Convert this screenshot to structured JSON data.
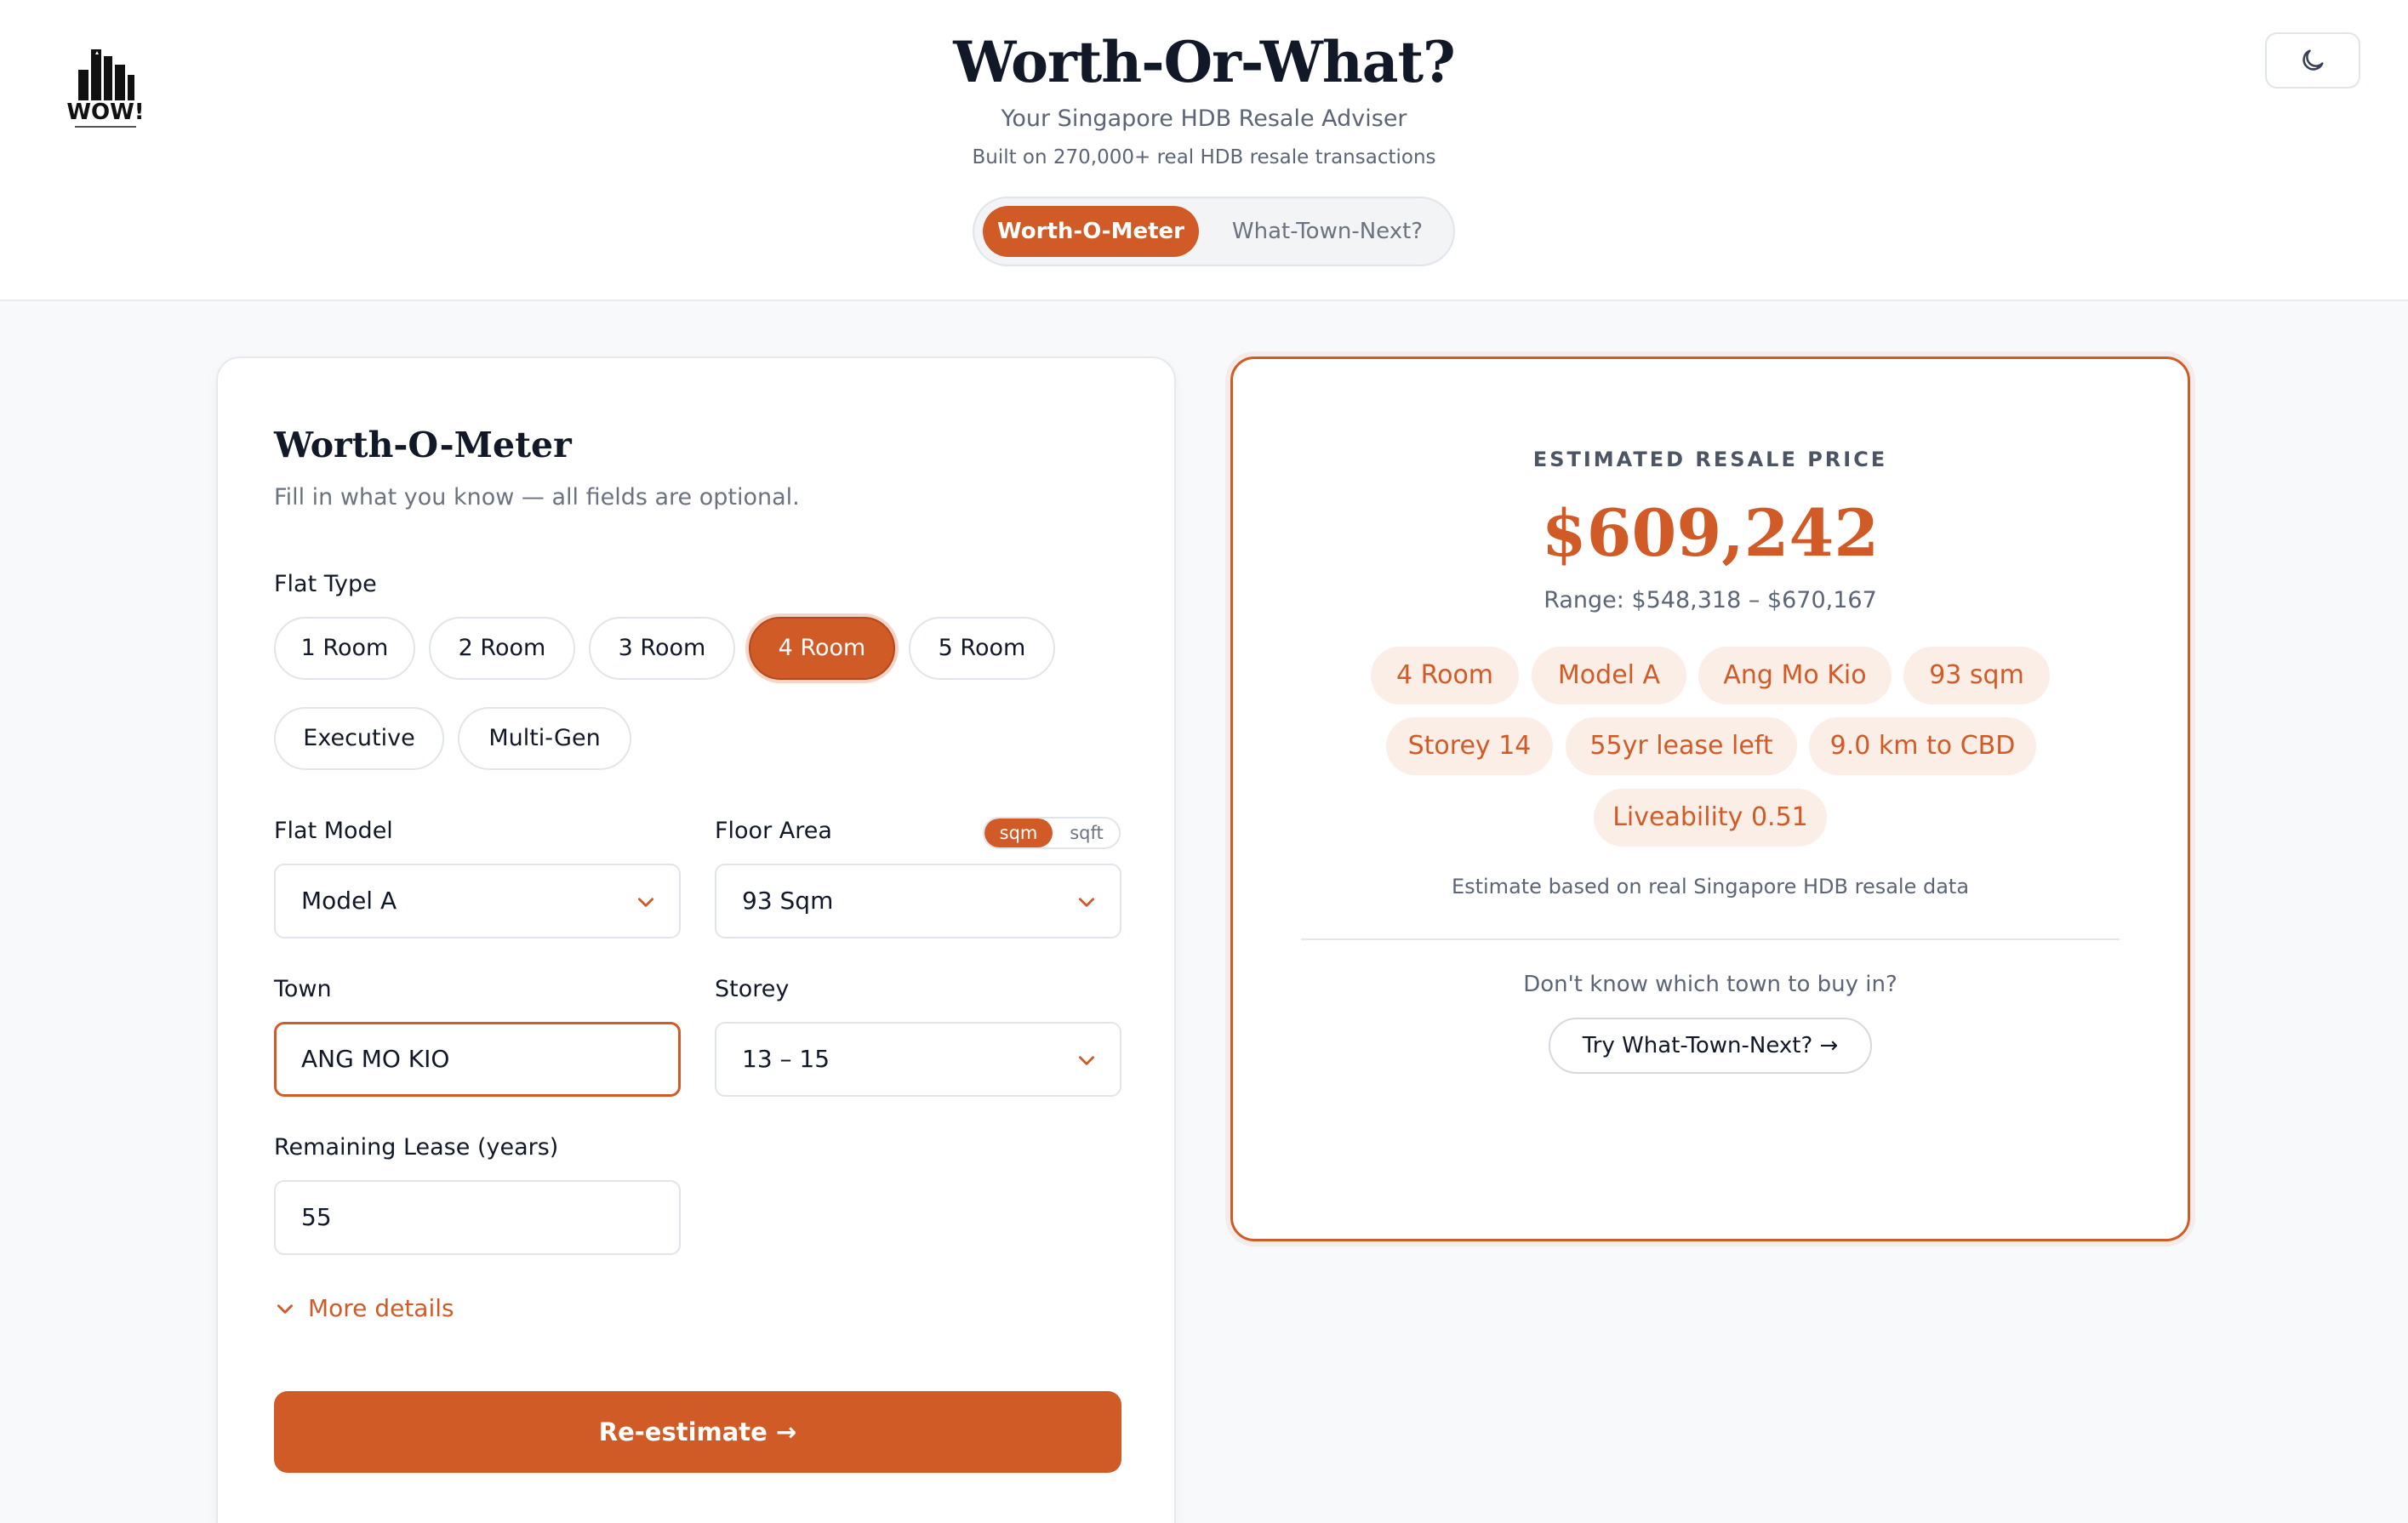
{
  "header": {
    "logo_text": "WOW!",
    "title": "Worth-Or-What?",
    "subtitle": "Your Singapore HDB Resale Adviser",
    "subline": "Built on 270,000+ real HDB resale transactions",
    "tabs": [
      {
        "label": "Worth-O-Meter",
        "active": true
      },
      {
        "label": "What-Town-Next?",
        "active": false
      }
    ],
    "theme_icon": "moon-icon"
  },
  "form": {
    "title": "Worth-O-Meter",
    "subtitle": "Fill in what you know — all fields are optional.",
    "flat_type": {
      "label": "Flat Type",
      "options": [
        "1 Room",
        "2 Room",
        "3 Room",
        "4 Room",
        "5 Room",
        "Executive",
        "Multi-Gen"
      ],
      "selected": "4 Room"
    },
    "flat_model": {
      "label": "Flat Model",
      "value": "Model A"
    },
    "floor_area": {
      "label": "Floor Area",
      "value": "93 Sqm",
      "units": [
        "sqm",
        "sqft"
      ],
      "selected_unit": "sqm"
    },
    "town": {
      "label": "Town",
      "value": "ANG MO KIO"
    },
    "storey": {
      "label": "Storey",
      "value": "13 – 15"
    },
    "lease": {
      "label": "Remaining Lease (years)",
      "value": "55"
    },
    "more_details": "More details",
    "submit": "Re-estimate →"
  },
  "result": {
    "eyebrow": "ESTIMATED RESALE PRICE",
    "price": "$609,242",
    "range": "Range: $548,318 – $670,167",
    "tags": [
      "4 Room",
      "Model A",
      "Ang Mo Kio",
      "93 sqm",
      "Storey 14",
      "55yr lease left",
      "9.0 km to CBD",
      "Liveability 0.51"
    ],
    "note": "Estimate based on real Singapore HDB resale data",
    "question": "Don't know which town to buy in?",
    "cta": "Try What-Town-Next? →"
  },
  "colors": {
    "accent": "#d15b27",
    "accent_soft": "#fbeee6",
    "text": "#111827",
    "muted": "#5b6576"
  }
}
